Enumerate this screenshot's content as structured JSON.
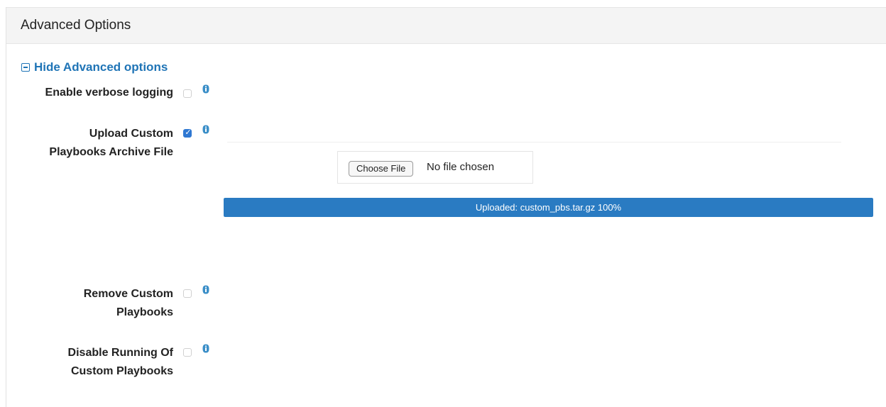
{
  "panel": {
    "title": "Advanced Options",
    "toggle_label": "Hide Advanced options"
  },
  "fields": [
    {
      "label_lines": [
        "Enable verbose logging"
      ],
      "checked": false,
      "info_icon": "info-icon"
    },
    {
      "label_lines": [
        "Upload Custom",
        "Playbooks Archive File"
      ],
      "checked": true,
      "info_icon": "info-icon"
    },
    {
      "label_lines": [
        "Remove Custom",
        "Playbooks"
      ],
      "checked": false,
      "info_icon": "info-icon"
    },
    {
      "label_lines": [
        "Disable Running Of",
        "Custom Playbooks"
      ],
      "checked": false,
      "info_icon": "info-icon"
    }
  ],
  "file_input": {
    "button_label": "Choose File",
    "status": "No file chosen"
  },
  "upload": {
    "text": "Uploaded: custom_pbs.tar.gz 100%",
    "progress": 1.0
  },
  "colors": {
    "accent": "#1f74b6",
    "progress": "#2a7bc2",
    "checkbox_checked": "#2f78d2"
  }
}
